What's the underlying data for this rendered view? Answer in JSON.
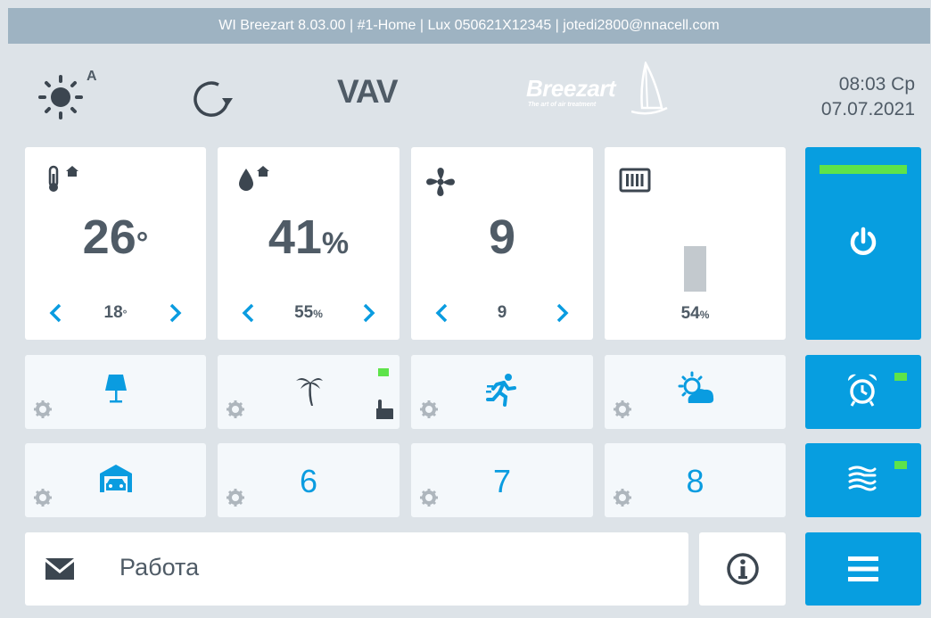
{
  "titlebar": {
    "text": "WI Breezart 8.03.00 | #1-Home | Lux 050621X12345 | jotedi2800@nnacell.com"
  },
  "header": {
    "weather_icon": "sun-icon",
    "weather_mode": "A",
    "refresh_icon": "refresh-icon",
    "mode": "VAV",
    "logo_name": "Breezart",
    "logo_tagline": "The art of air treatment",
    "time": "08:03 Ср",
    "date": "07.07.2021"
  },
  "tiles": {
    "temperature": {
      "icon": "thermometer-home-icon",
      "current": "26",
      "current_unit": "°",
      "set": "18",
      "set_unit": "°"
    },
    "humidity": {
      "icon": "humidity-home-icon",
      "current": "41",
      "current_unit": "%",
      "set": "55",
      "set_unit": "%"
    },
    "fan": {
      "icon": "fan-icon",
      "current": "9",
      "set": "9"
    },
    "heater": {
      "icon": "heater-icon",
      "level_percent": 54,
      "value": "54",
      "value_unit": "%"
    },
    "power": {
      "icon": "power-icon",
      "indicator": "on"
    }
  },
  "scenes": [
    {
      "icon": "lamp-icon",
      "label": ""
    },
    {
      "icon": "palm-tree-icon",
      "label": "",
      "hand_icon": "hand-pointer-icon",
      "indicator": "on"
    },
    {
      "icon": "running-man-icon",
      "label": ""
    },
    {
      "icon": "sun-cloud-icon",
      "label": ""
    },
    {
      "icon": "garage-car-icon",
      "label": ""
    },
    {
      "icon": "",
      "label": "6"
    },
    {
      "icon": "",
      "label": "7"
    },
    {
      "icon": "",
      "label": "8"
    }
  ],
  "side_buttons": {
    "alarm": {
      "icon": "alarm-clock-icon",
      "indicator": "on"
    },
    "filter": {
      "icon": "filter-icon",
      "indicator": "on"
    },
    "menu": {
      "icon": "menu-icon"
    }
  },
  "status": {
    "icon": "envelope-icon",
    "text": "Работа",
    "info_icon": "info-icon"
  },
  "colors": {
    "accent": "#079ee0",
    "indicator": "#5ee34a",
    "text": "#4f5b66",
    "background": "#dde3e8",
    "titlebar": "#9eb3c2"
  }
}
